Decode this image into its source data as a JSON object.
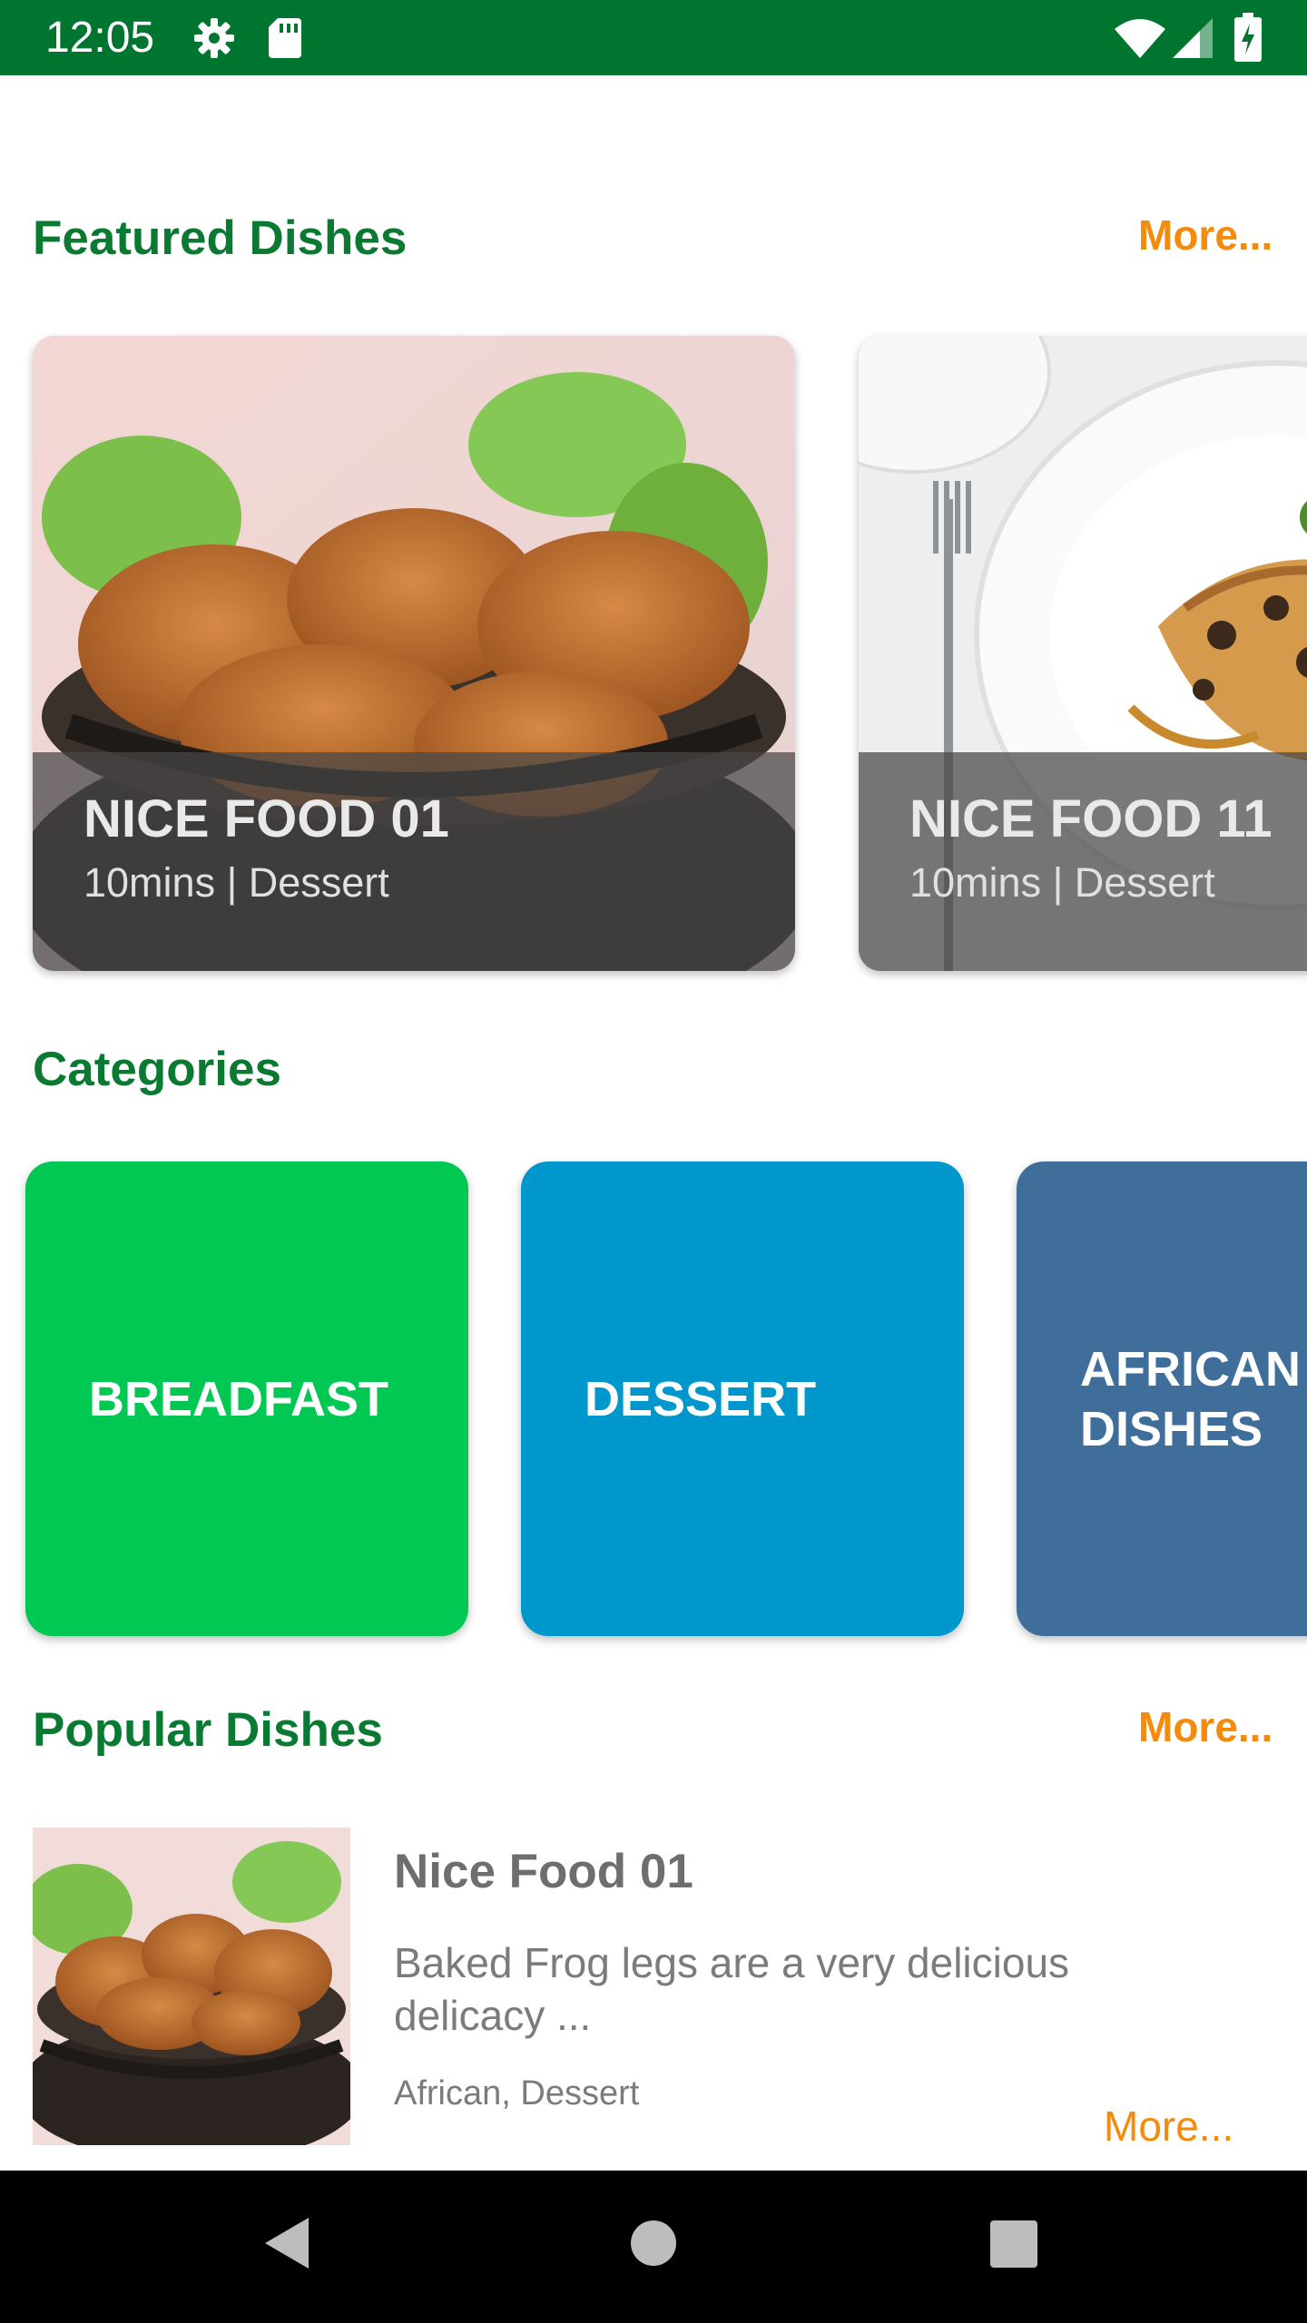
{
  "status_bar": {
    "time": "12:05",
    "icons": [
      "settings-icon",
      "sd-card-icon",
      "wifi-icon",
      "signal-icon",
      "battery-icon"
    ]
  },
  "featured": {
    "title": "Featured Dishes",
    "more": "More...",
    "cards": [
      {
        "title": "NICE FOOD 01",
        "subtitle": "10mins | Dessert",
        "image": "fried-chicken-basket"
      },
      {
        "title": "NICE FOOD 11",
        "subtitle": "10mins | Dessert",
        "image": "plated-fish-dish"
      }
    ]
  },
  "categories": {
    "title": "Categories",
    "items": [
      {
        "label": "BREADFAST",
        "color": "#00c853"
      },
      {
        "label": "DESSERT",
        "color": "#0097cc"
      },
      {
        "label": "AFRICAN DISHES",
        "color": "#3f6e9b"
      }
    ]
  },
  "popular": {
    "title": "Popular Dishes",
    "more": "More...",
    "items": [
      {
        "name": "Nice Food 01",
        "description": "Baked Frog legs are a very delicious delicacy ...",
        "tags": "African, Dessert",
        "more": "More...",
        "image": "fried-chicken-basket"
      }
    ]
  },
  "nav_bar": {
    "buttons": [
      "back-icon",
      "home-icon",
      "recents-icon"
    ]
  },
  "colors": {
    "status_bar": "#007530",
    "section_title": "#0a7a33",
    "accent": "#f58b0c"
  }
}
